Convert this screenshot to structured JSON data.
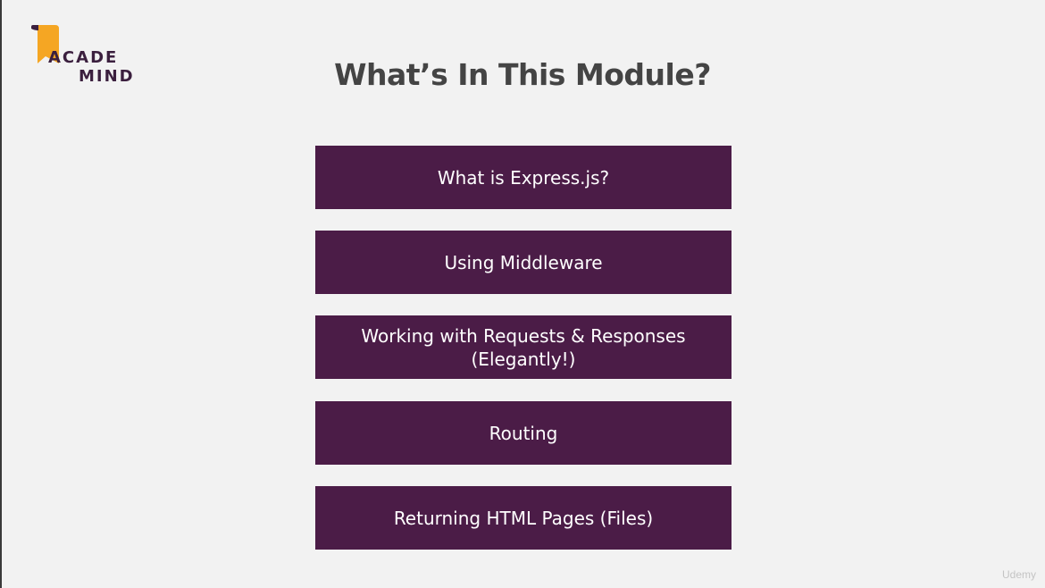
{
  "slide": {
    "logo": {
      "line1": "ACADE",
      "line2": "MIND",
      "colors": {
        "mark": "#f5a623",
        "text": "#3b1f3e"
      }
    },
    "title": "What’s In This Module?",
    "topics": [
      {
        "label": "What is Express.js?"
      },
      {
        "label": "Using Middleware"
      },
      {
        "label": "Working with Requests & Responses\n(Elegantly!)"
      },
      {
        "label": "Routing"
      },
      {
        "label": "Returning HTML Pages (Files)"
      }
    ],
    "watermark": "Udemy"
  },
  "theme": {
    "background": "#f2f2f2",
    "topic_bg": "#4b1c47",
    "topic_text": "#ffffff",
    "title_color": "#444444"
  }
}
